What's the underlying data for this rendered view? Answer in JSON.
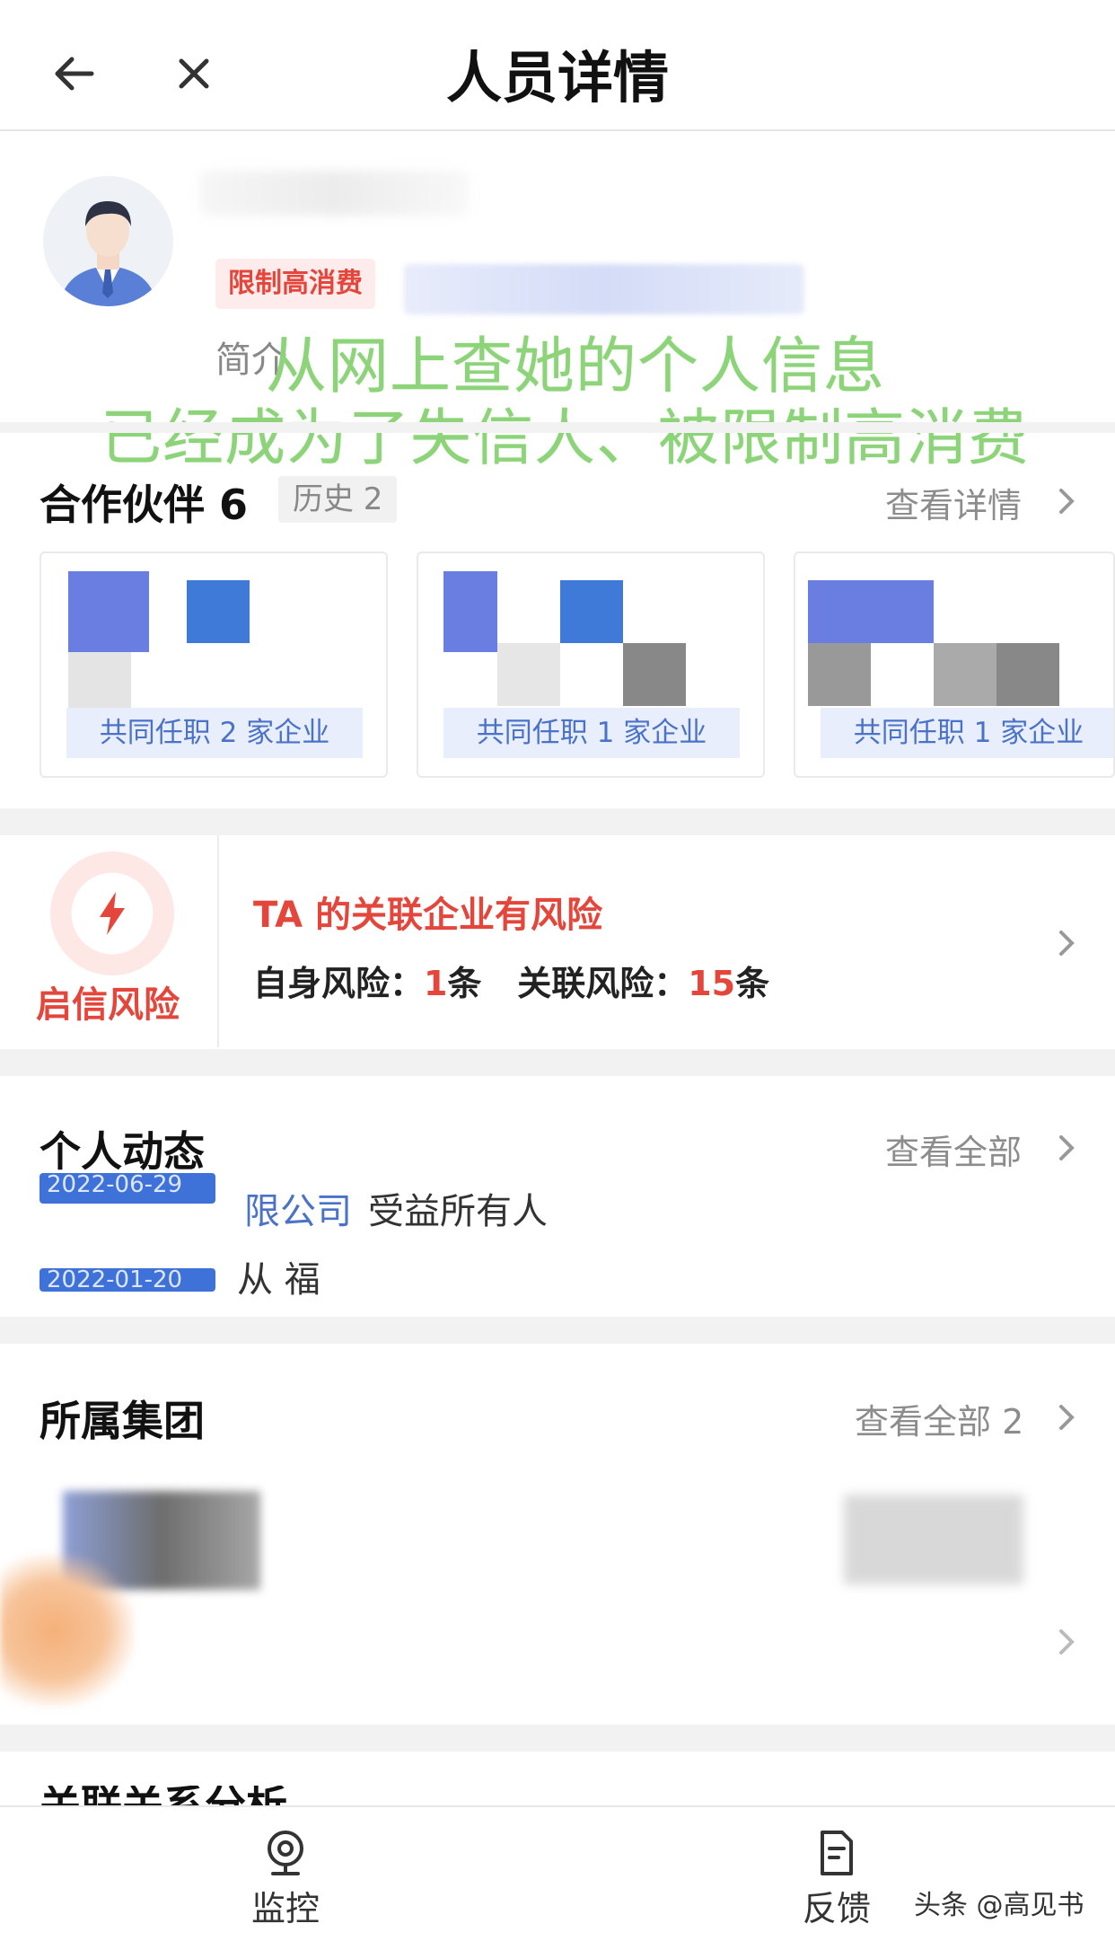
{
  "header": {
    "title": "人员详情"
  },
  "profile": {
    "tag": "限制高消费",
    "intro_label": "简介"
  },
  "overlay": {
    "line1": "从网上查她的个人信息",
    "line2": "已经成为了失信人、被限制高消费"
  },
  "partners": {
    "title": "合作伙伴 6",
    "history_badge": "历史 2",
    "link": "查看详情",
    "cards": [
      {
        "caption": "共同任职 2 家企业"
      },
      {
        "caption": "共同任职 1 家企业"
      },
      {
        "caption": "共同任职 1 家企业"
      }
    ]
  },
  "risk": {
    "label": "启信风险",
    "headline": "TA 的关联企业有风险",
    "self_label": "自身风险：",
    "self_count": "1",
    "self_unit": "条",
    "related_label": "关联风险：",
    "related_count": "15",
    "related_unit": "条"
  },
  "dynamics": {
    "title": "个人动态",
    "link": "查看全部",
    "items": [
      {
        "date": "2022-06-29",
        "company": "限公司",
        "role": "受益所有人"
      },
      {
        "date": "2022-01-20",
        "text": "从 福"
      }
    ]
  },
  "group": {
    "title": "所属集团",
    "link": "查看全部 2"
  },
  "next_section_partial": "关联关系分析",
  "bottom_bar": {
    "monitor_label": "监控",
    "feedback_label": "反馈",
    "source_watermark": "头条 @高见书"
  },
  "colors": {
    "accent_red": "#e5463b",
    "link_blue": "#4a72c9",
    "overlay_green": "#8dd37a"
  }
}
